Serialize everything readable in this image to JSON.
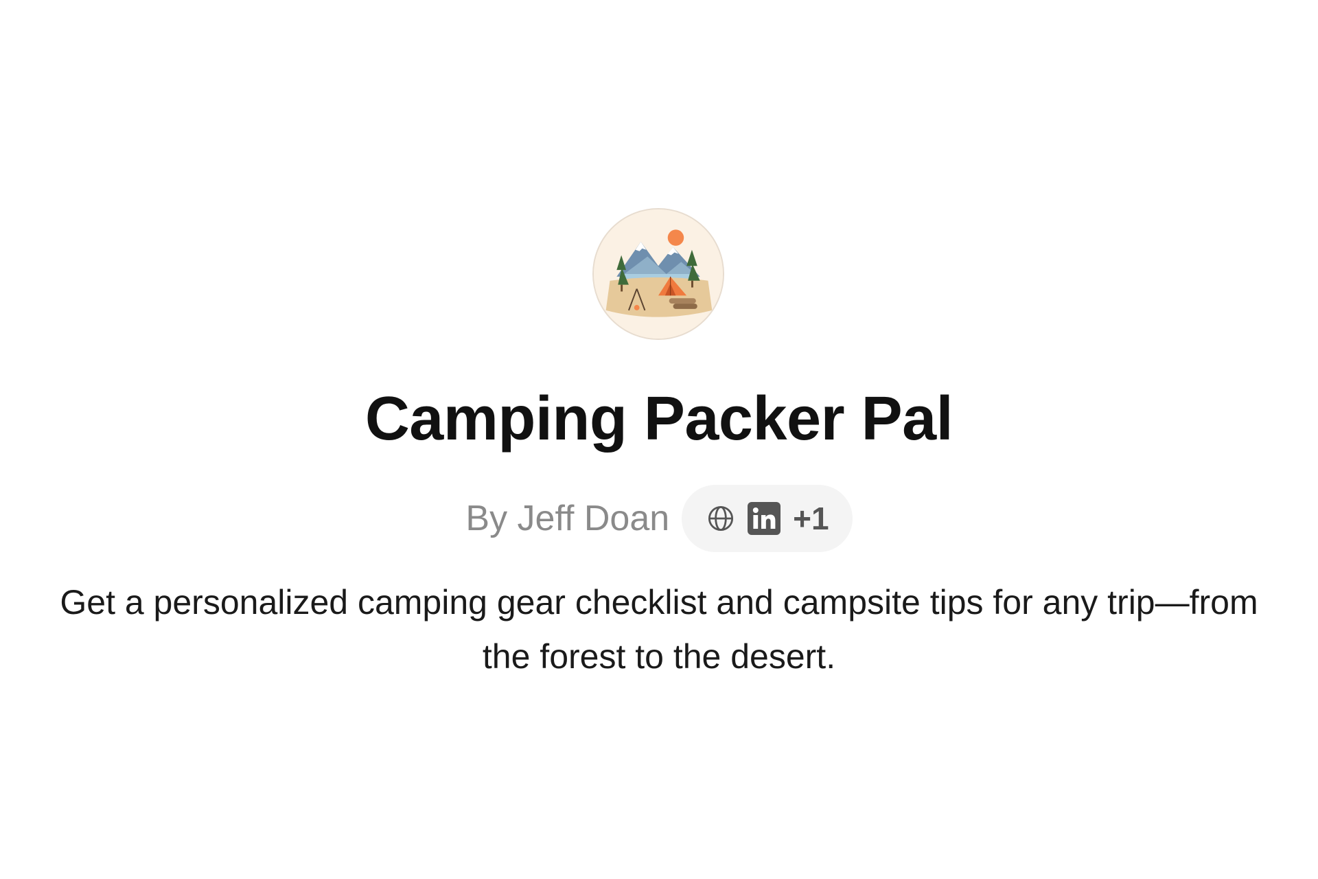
{
  "gpt": {
    "name": "Camping Packer Pal",
    "author": "By Jeff Doan",
    "links": {
      "icons": [
        "globe-icon",
        "linkedin-icon"
      ],
      "more_count": "+1"
    },
    "description": "Get a personalized camping gear checklist and campsite tips for any trip—from the forest to the desert."
  },
  "colors": {
    "title": "#111111",
    "author": "#8a8a8a",
    "pill_background": "#f4f4f4",
    "avatar_background": "#fbf1e4",
    "tent": "#f07a3e",
    "sun": "#f4874b"
  }
}
